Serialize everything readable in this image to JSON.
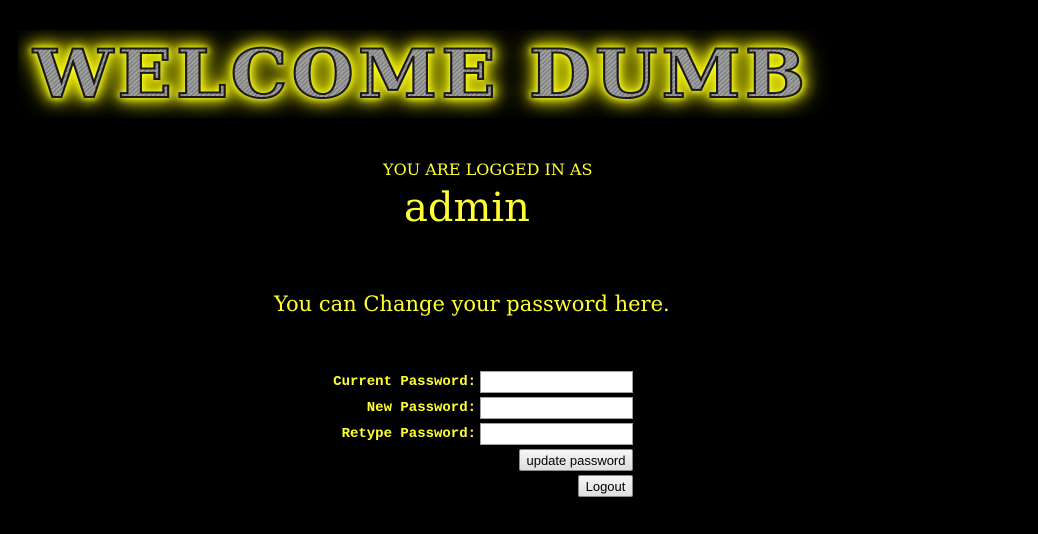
{
  "banner": {
    "title": "WELCOME DUMB"
  },
  "session": {
    "logged_in_label": "YOU ARE LOGGED IN AS",
    "username": "admin"
  },
  "form": {
    "message": "You can Change your password here.",
    "current_password_label": "Current Password:",
    "current_password_value": "",
    "new_password_label": "New Password:",
    "new_password_value": "",
    "retype_password_label": "Retype Password:",
    "retype_password_value": "",
    "update_button_label": "update password",
    "logout_button_label": "Logout"
  },
  "colors": {
    "background": "#000000",
    "text": "#ffff33",
    "banner_glow": "#ffff33"
  }
}
